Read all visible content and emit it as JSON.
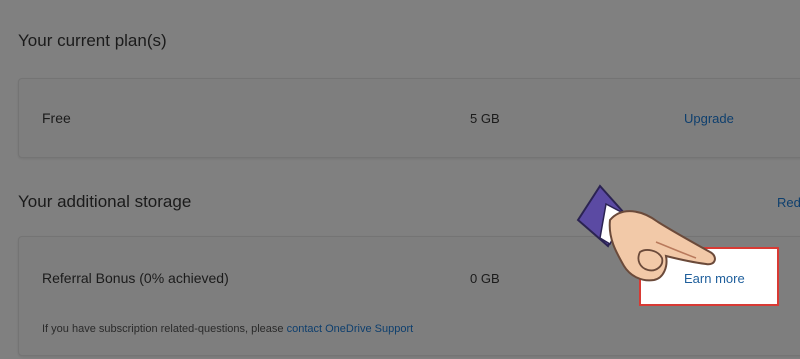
{
  "sections": {
    "plan_title": "Your current plan(s)",
    "storage_title": "Your additional storage"
  },
  "plan": {
    "name": "Free",
    "size": "5 GB",
    "action": "Upgrade"
  },
  "storage": {
    "redeem_partial": "Red",
    "bonus_label": "Referral Bonus (0% achieved)",
    "bonus_size": "0 GB",
    "bonus_action": "Earn more",
    "note_prefix": "If you have subscription related-questions, please ",
    "note_link": "contact OneDrive Support"
  },
  "colors": {
    "overlay": "#808080",
    "link": "#0e3f6e",
    "highlight_border": "#d83a34",
    "hand_sleeve": "#5b4aa3",
    "hand_skin": "#f2c9a8"
  }
}
